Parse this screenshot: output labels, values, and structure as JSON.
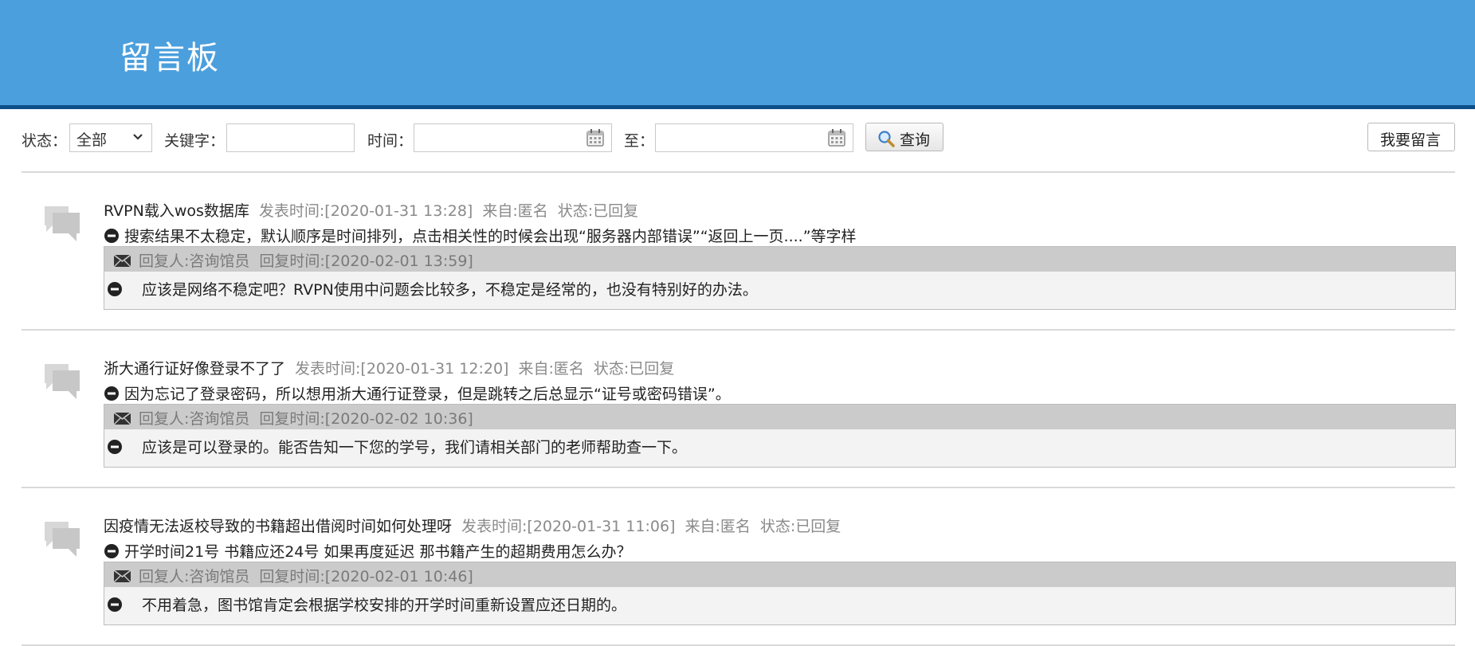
{
  "header": {
    "title": "留言板"
  },
  "filters": {
    "status_label": "状态：",
    "status_value": "全部",
    "keyword_label": "关键字：",
    "keyword_value": "",
    "time_label": "时间：",
    "time_from_value": "",
    "to_label": "至：",
    "time_to_value": "",
    "search_button": "查询",
    "leave_message_button": "我要留言"
  },
  "messages": [
    {
      "title": "RVPN载入wos数据库",
      "post_time": "发表时间:[2020-01-31 13:28]",
      "source": "来自:匿名",
      "status": "状态:已回复",
      "content": "搜索结果不太稳定，默认顺序是时间排列，点击相关性的时候会出现“服务器内部错误”“返回上一页....”等字样",
      "reply_by": "回复人:咨询馆员",
      "reply_time": "回复时间:[2020-02-01 13:59]",
      "reply_content": "应该是网络不稳定吧？RVPN使用中问题会比较多，不稳定是经常的，也没有特别好的办法。"
    },
    {
      "title": "浙大通行证好像登录不了了",
      "post_time": "发表时间:[2020-01-31 12:20]",
      "source": "来自:匿名",
      "status": "状态:已回复",
      "content": "因为忘记了登录密码，所以想用浙大通行证登录，但是跳转之后总显示“证号或密码错误”。",
      "reply_by": "回复人:咨询馆员",
      "reply_time": "回复时间:[2020-02-02 10:36]",
      "reply_content": "应该是可以登录的。能否告知一下您的学号，我们请相关部门的老师帮助查一下。"
    },
    {
      "title": "因疫情无法返校导致的书籍超出借阅时间如何处理呀",
      "post_time": "发表时间:[2020-01-31 11:06]",
      "source": "来自:匿名",
      "status": "状态:已回复",
      "content": "开学时间21号 书籍应还24号 如果再度延迟 那书籍产生的超期费用怎么办？",
      "reply_by": "回复人:咨询馆员",
      "reply_time": "回复时间:[2020-02-01 10:46]",
      "reply_content": "不用着急，图书馆肯定会根据学校安排的开学时间重新设置应还日期的。"
    }
  ]
}
